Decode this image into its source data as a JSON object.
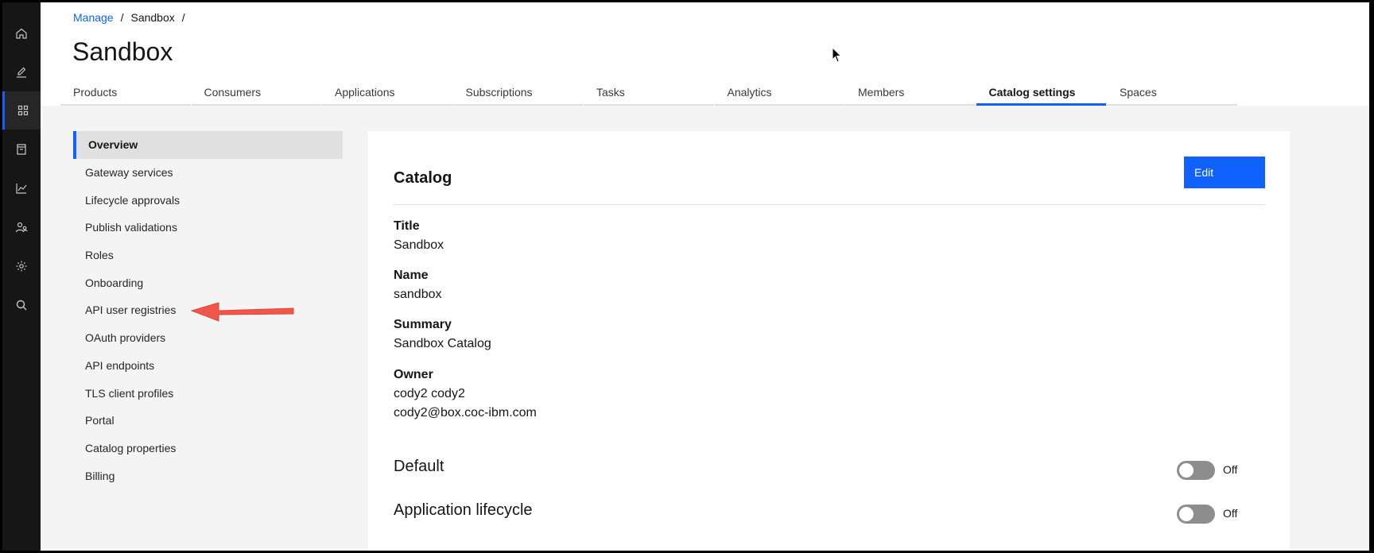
{
  "breadcrumb": {
    "root": "Manage",
    "current": "Sandbox",
    "separator": "/"
  },
  "page": {
    "title": "Sandbox"
  },
  "tabs": [
    {
      "label": "Products"
    },
    {
      "label": "Consumers"
    },
    {
      "label": "Applications"
    },
    {
      "label": "Subscriptions"
    },
    {
      "label": "Tasks"
    },
    {
      "label": "Analytics"
    },
    {
      "label": "Members"
    },
    {
      "label": "Catalog settings",
      "active": true
    },
    {
      "label": "Spaces"
    }
  ],
  "rail": {
    "icons": [
      "home-icon",
      "edit-icon",
      "dashboard-icon",
      "catalog-icon",
      "analytics-icon",
      "members-icon",
      "settings-icon",
      "search-icon"
    ],
    "active": "dashboard-icon"
  },
  "sidenav": {
    "items": [
      {
        "label": "Overview",
        "active": true
      },
      {
        "label": "Gateway services"
      },
      {
        "label": "Lifecycle approvals"
      },
      {
        "label": "Publish validations"
      },
      {
        "label": "Roles"
      },
      {
        "label": "Onboarding"
      },
      {
        "label": "API user registries"
      },
      {
        "label": "OAuth providers"
      },
      {
        "label": "API endpoints"
      },
      {
        "label": "TLS client profiles"
      },
      {
        "label": "Portal"
      },
      {
        "label": "Catalog properties"
      },
      {
        "label": "Billing"
      }
    ]
  },
  "catalog": {
    "heading": "Catalog",
    "edit_label": "Edit",
    "title_label": "Title",
    "title_value": "Sandbox",
    "name_label": "Name",
    "name_value": "sandbox",
    "summary_label": "Summary",
    "summary_value": "Sandbox Catalog",
    "owner_label": "Owner",
    "owner_name": "cody2 cody2",
    "owner_email": "cody2@box.coc-ibm.com"
  },
  "toggles": {
    "default_label": "Default",
    "default_state": "Off",
    "lifecycle_label": "Application lifecycle",
    "lifecycle_state": "Off"
  },
  "colors": {
    "accent": "#0f62fe",
    "rail_bg": "#161616",
    "annotation_arrow": "#f0574a"
  }
}
